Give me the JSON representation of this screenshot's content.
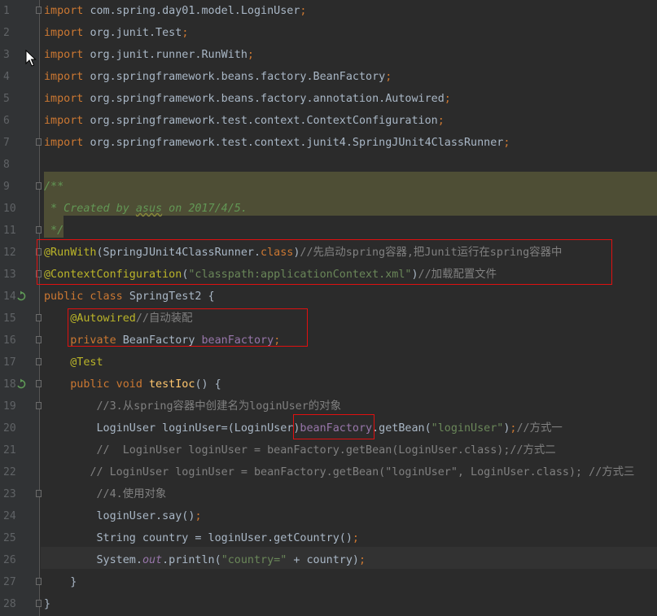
{
  "editor": {
    "lines": [
      {
        "no": "1",
        "t": [
          {
            "k": "kw",
            "v": "import "
          },
          {
            "v": "com.spring.day01.model.LoginUser"
          },
          {
            "k": "kw",
            "v": ";"
          }
        ]
      },
      {
        "no": "2",
        "t": [
          {
            "k": "kw",
            "v": "import "
          },
          {
            "v": "org.junit.Test"
          },
          {
            "k": "kw",
            "v": ";"
          }
        ]
      },
      {
        "no": "3",
        "t": [
          {
            "k": "kw",
            "v": "import "
          },
          {
            "v": "org.junit.runner.RunWith"
          },
          {
            "k": "kw",
            "v": ";"
          }
        ]
      },
      {
        "no": "4",
        "t": [
          {
            "k": "kw",
            "v": "import "
          },
          {
            "v": "org.springframework.beans.factory.BeanFactory"
          },
          {
            "k": "kw",
            "v": ";"
          }
        ]
      },
      {
        "no": "5",
        "t": [
          {
            "k": "kw",
            "v": "import "
          },
          {
            "v": "org.springframework.beans.factory.annotation.Autowired"
          },
          {
            "k": "kw",
            "v": ";"
          }
        ]
      },
      {
        "no": "6",
        "t": [
          {
            "k": "kw",
            "v": "import "
          },
          {
            "v": "org.springframework.test.context.ContextConfiguration"
          },
          {
            "k": "kw",
            "v": ";"
          }
        ]
      },
      {
        "no": "7",
        "t": [
          {
            "k": "kw",
            "v": "import "
          },
          {
            "v": "org.springframework.test.context.junit4.SpringJUnit4ClassRunner"
          },
          {
            "k": "kw",
            "v": ";"
          }
        ]
      },
      {
        "no": "8",
        "t": []
      },
      {
        "no": "9",
        "t": [
          {
            "k": "doc",
            "v": "/**"
          }
        ]
      },
      {
        "no": "10",
        "t": [
          {
            "k": "doc",
            "v": " * Created by "
          },
          {
            "k": "doc-u",
            "v": "asus"
          },
          {
            "k": "doc",
            "v": " on 2017/4/5."
          }
        ]
      },
      {
        "no": "11",
        "t": [
          {
            "k": "doc",
            "v": " */"
          }
        ]
      },
      {
        "no": "12",
        "t": [
          {
            "k": "ann",
            "v": "@RunWith"
          },
          {
            "v": "(SpringJUnit4ClassRunner."
          },
          {
            "k": "kw",
            "v": "class"
          },
          {
            "v": ")"
          },
          {
            "k": "cmt",
            "v": "//先启动spring容器,把Junit运行在spring容器中"
          }
        ]
      },
      {
        "no": "13",
        "t": [
          {
            "k": "ann",
            "v": "@ContextConfiguration"
          },
          {
            "v": "("
          },
          {
            "k": "str",
            "v": "\"classpath:applicationContext.xml\""
          },
          {
            "v": ")"
          },
          {
            "k": "cmt",
            "v": "//加载配置文件"
          }
        ]
      },
      {
        "no": "14",
        "t": [
          {
            "k": "kw",
            "v": "public class "
          },
          {
            "v": "SpringTest2 {"
          }
        ]
      },
      {
        "no": "15",
        "t": [
          {
            "v": "    "
          },
          {
            "k": "ann",
            "v": "@Autowired"
          },
          {
            "k": "cmt",
            "v": "//自动装配"
          }
        ]
      },
      {
        "no": "16",
        "t": [
          {
            "v": "    "
          },
          {
            "k": "kw",
            "v": "private "
          },
          {
            "v": "BeanFactory "
          },
          {
            "k": "fld",
            "v": "beanFactory"
          },
          {
            "k": "kw",
            "v": ";"
          }
        ]
      },
      {
        "no": "17",
        "t": [
          {
            "v": "    "
          },
          {
            "k": "ann",
            "v": "@Test"
          }
        ]
      },
      {
        "no": "18",
        "t": [
          {
            "v": "    "
          },
          {
            "k": "kw",
            "v": "public void "
          },
          {
            "k": "fn",
            "v": "testIoc"
          },
          {
            "v": "() {"
          }
        ]
      },
      {
        "no": "19",
        "t": [
          {
            "v": "        "
          },
          {
            "k": "cmt",
            "v": "//3.从spring容器中创建名为loginUser的对象"
          }
        ]
      },
      {
        "no": "20",
        "t": [
          {
            "v": "        LoginUser loginUser=(LoginUser)"
          },
          {
            "k": "fld",
            "v": "beanFactory"
          },
          {
            "v": ".getBean("
          },
          {
            "k": "str",
            "v": "\"loginUser\""
          },
          {
            "v": ")"
          },
          {
            "k": "kw",
            "v": ";"
          },
          {
            "k": "cmt",
            "v": "//方式一"
          }
        ]
      },
      {
        "no": "21",
        "t": [
          {
            "v": "        "
          },
          {
            "k": "cmt",
            "v": "//  LoginUser loginUser = beanFactory.getBean(LoginUser.class);//方式二"
          }
        ]
      },
      {
        "no": "22",
        "t": [
          {
            "v": "       "
          },
          {
            "k": "cmt",
            "v": "// LoginUser loginUser = beanFactory.getBean(\"loginUser\", LoginUser.class); //方式三"
          }
        ]
      },
      {
        "no": "23",
        "t": [
          {
            "v": "        "
          },
          {
            "k": "cmt",
            "v": "//4.使用对象"
          }
        ]
      },
      {
        "no": "24",
        "t": [
          {
            "v": "        loginUser.say()"
          },
          {
            "k": "kw",
            "v": ";"
          }
        ]
      },
      {
        "no": "25",
        "t": [
          {
            "v": "        String country = loginUser.getCountry()"
          },
          {
            "k": "kw",
            "v": ";"
          }
        ]
      },
      {
        "no": "26",
        "t": [
          {
            "v": "        System."
          },
          {
            "k": "sfld",
            "v": "out"
          },
          {
            "v": ".println("
          },
          {
            "k": "str",
            "v": "\"country=\""
          },
          {
            "v": " + country)"
          },
          {
            "k": "kw",
            "v": ";"
          }
        ]
      },
      {
        "no": "27",
        "t": [
          {
            "v": "    }"
          }
        ]
      },
      {
        "no": "28",
        "t": [
          {
            "v": "}"
          }
        ]
      }
    ],
    "fold_lines": [
      "1",
      "7",
      "9",
      "11",
      "12",
      "13",
      "15",
      "16",
      "17",
      "18",
      "19",
      "23",
      "27",
      "28"
    ],
    "run_icon_lines": [
      "14",
      "18"
    ],
    "colors": {
      "background": "#2b2b2b",
      "gutter": "#313335",
      "keyword": "#cc7832",
      "comment": "#808080",
      "doc_comment": "#629755",
      "annotation": "#bbb529",
      "string": "#6a8759",
      "field": "#9876aa",
      "method": "#ffc66d",
      "highlight_box": "#e01010"
    }
  }
}
